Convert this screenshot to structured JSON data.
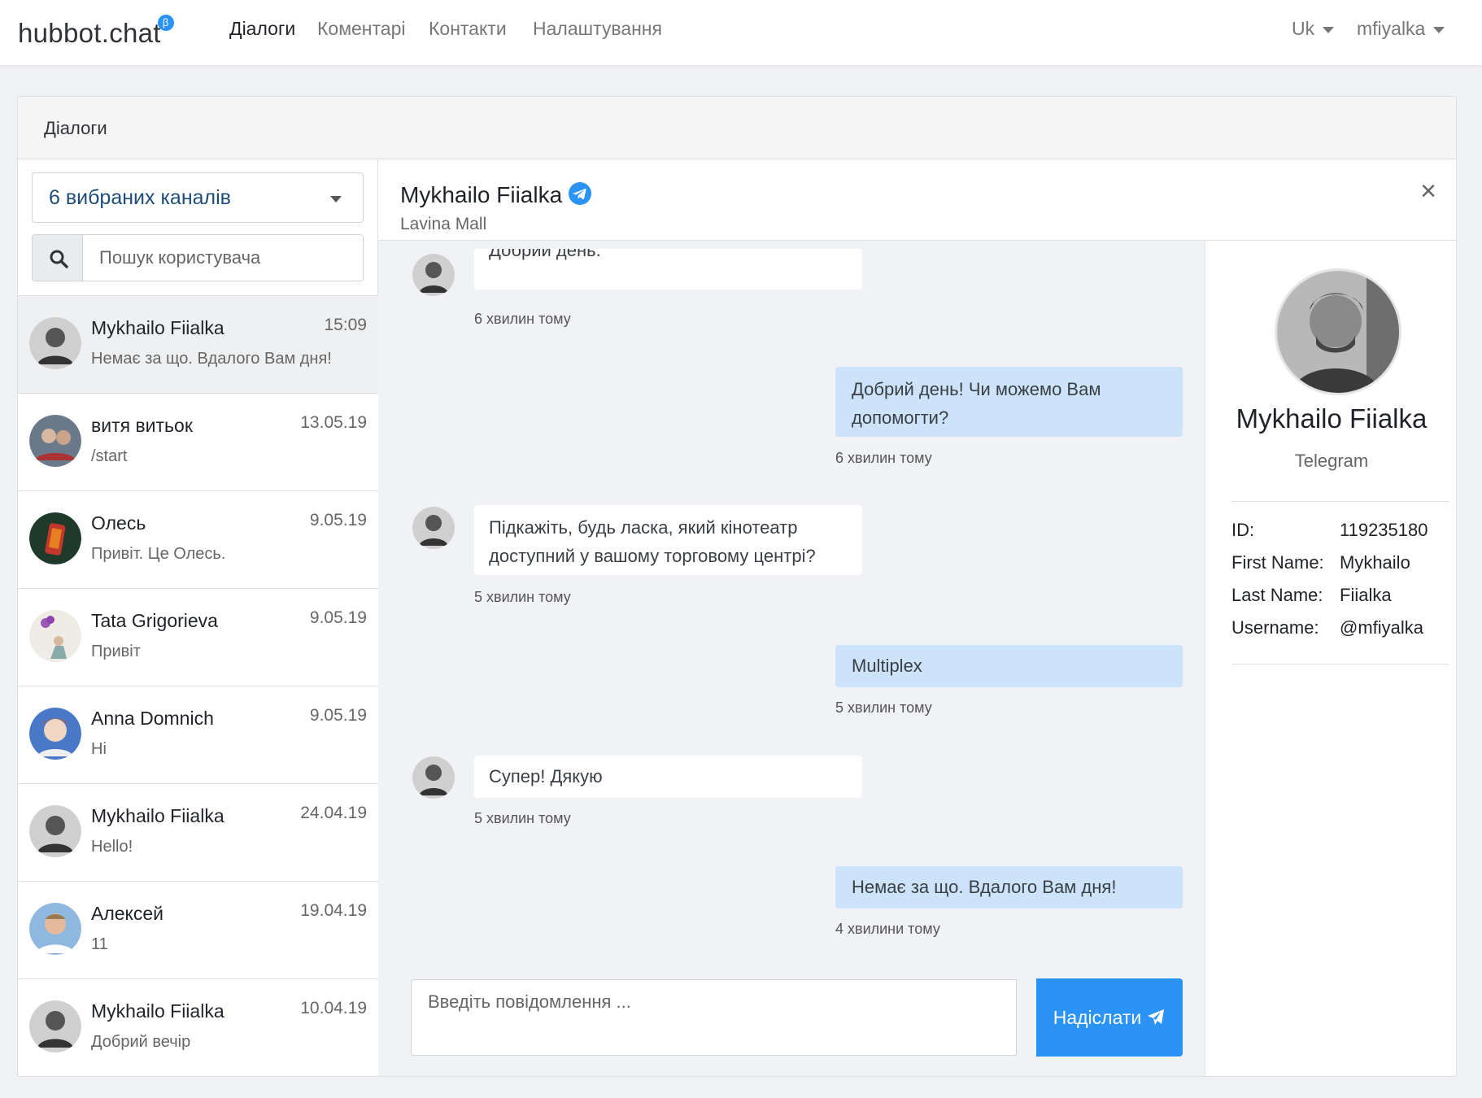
{
  "navbar": {
    "brand": "hubbot.chat",
    "beta": "β",
    "links": [
      "Діалоги",
      "Коментарі",
      "Контакти",
      "Налаштування"
    ],
    "lang": "Uk",
    "user": "mfiyalka"
  },
  "card": {
    "title": "Діалоги"
  },
  "left": {
    "channels_label": "6 вибраних каналів",
    "search_placeholder": "Пошук користувача",
    "dialogs": [
      {
        "name": "Mykhailo Fiialka",
        "time": "15:09",
        "last": "Немає за що. Вдалого Вам дня!"
      },
      {
        "name": "витя витьок",
        "time": "13.05.19",
        "last": "/start"
      },
      {
        "name": "Олесь",
        "time": "9.05.19",
        "last": "Привіт. Це Олесь."
      },
      {
        "name": "Tata Grigorieva",
        "time": "9.05.19",
        "last": "Привіт"
      },
      {
        "name": "Anna Domnich",
        "time": "9.05.19",
        "last": "Hi"
      },
      {
        "name": "Mykhailo Fiialka",
        "time": "24.04.19",
        "last": "Hello!"
      },
      {
        "name": "Алексей",
        "time": "19.04.19",
        "last": "11"
      },
      {
        "name": "Mykhailo Fiialka",
        "time": "10.04.19",
        "last": "Добрий вечір"
      }
    ]
  },
  "conversation": {
    "title": "Mykhailo Fiialka",
    "subtitle": "Lavina Mall",
    "close": "×",
    "messages": [
      {
        "text": "Добрий день.",
        "time": "6 хвилин тому"
      },
      {
        "text": "Добрий день! Чи можемо Вам допомогти?",
        "time": "6 хвилин тому"
      },
      {
        "text": "Підкажіть, будь ласка, який кінотеатр доступний у вашому торговому центрі?",
        "time": "5 хвилин тому"
      },
      {
        "text": "Multiplex",
        "time": "5 хвилин тому"
      },
      {
        "text": "Супер! Дякую",
        "time": "5 хвилин тому"
      },
      {
        "text": "Немає за що. Вдалого Вам дня!",
        "time": "4 хвилини тому"
      }
    ],
    "input_placeholder": "Введіть повідомлення ...",
    "send_label": "Надіслати"
  },
  "profile": {
    "name": "Mykhailo Fiialka",
    "channel": "Telegram",
    "fields": [
      {
        "k": "ID:",
        "v": "119235180"
      },
      {
        "k": "First Name:",
        "v": "Mykhailo"
      },
      {
        "k": "Last Name:",
        "v": "Fiialka"
      },
      {
        "k": "Username:",
        "v": "@mfiyalka"
      }
    ]
  },
  "colors": {
    "accent": "#2a93f5",
    "outgoing_bubble": "#cce3f9",
    "chat_bg": "#f0f2f5"
  }
}
